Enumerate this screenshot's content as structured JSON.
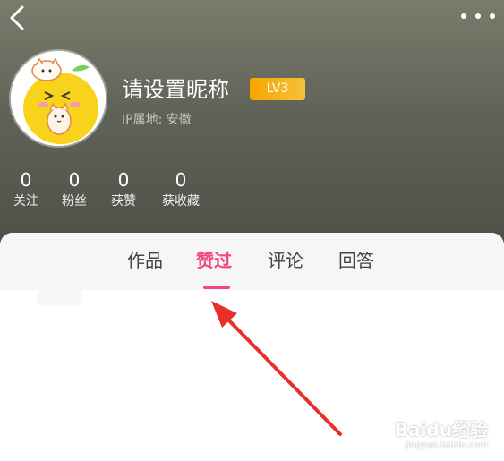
{
  "profile": {
    "nickname": "请设置昵称",
    "level": "LV3",
    "ip_location": "IP属地: 安徽"
  },
  "stats": [
    {
      "value": "0",
      "label": "关注"
    },
    {
      "value": "0",
      "label": "粉丝"
    },
    {
      "value": "0",
      "label": "获赞"
    },
    {
      "value": "0",
      "label": "获收藏"
    }
  ],
  "tabs": [
    {
      "label": "作品",
      "active": false
    },
    {
      "label": "赞过",
      "active": true
    },
    {
      "label": "评论",
      "active": false
    },
    {
      "label": "回答",
      "active": false
    }
  ],
  "watermark": {
    "brand": "Baidu经验",
    "url": "jingyan.baidu.com"
  },
  "colors": {
    "accent_pink": "#f2487f",
    "level_badge": "#f7a400",
    "arrow_red": "#e8302a"
  },
  "icons": [
    "back-arrow-icon",
    "more-dots-icon",
    "avatar-cartoon",
    "red-arrow-annotation"
  ]
}
